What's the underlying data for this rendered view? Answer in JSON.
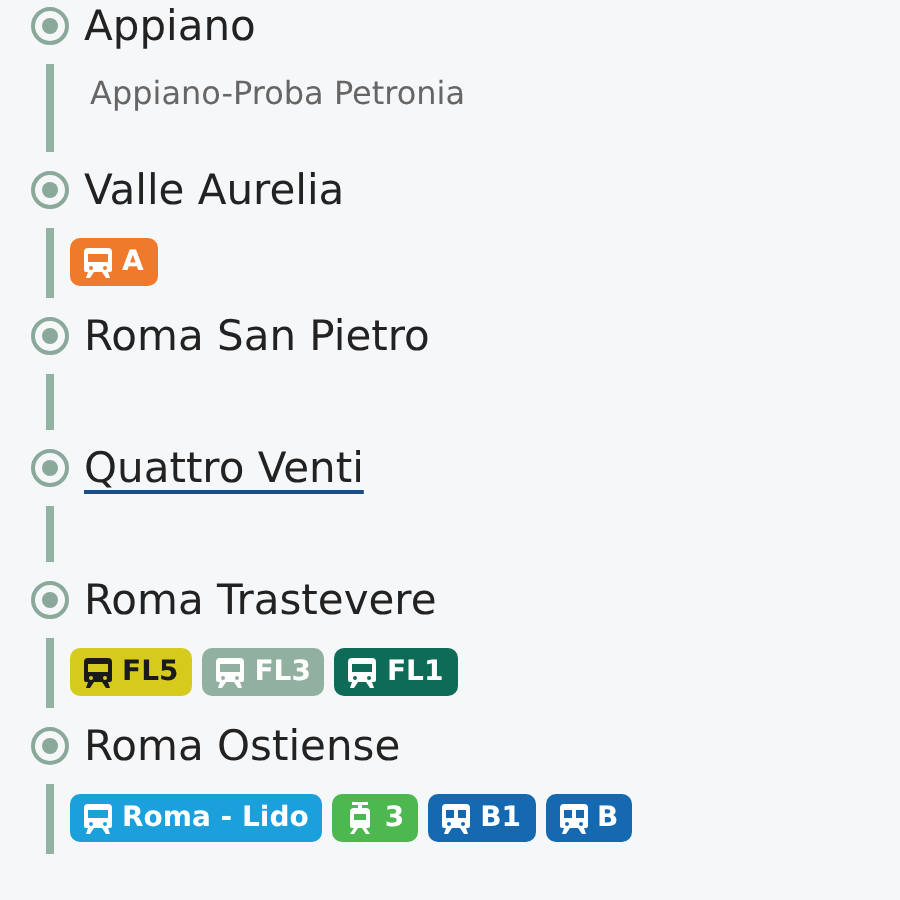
{
  "stops": [
    {
      "name": "Appiano",
      "link": false,
      "subtitle": "Appiano-Proba Petronia"
    },
    {
      "name": "Valle Aurelia",
      "link": false,
      "lines": [
        {
          "label": "A",
          "kind": "train",
          "color": "#ef7a2c",
          "dark_text": false
        }
      ]
    },
    {
      "name": "Roma San Pietro",
      "link": false
    },
    {
      "name": "Quattro Venti",
      "link": true
    },
    {
      "name": "Roma Trastevere",
      "link": false,
      "lines": [
        {
          "label": "FL5",
          "kind": "train",
          "color": "#d6cb1c",
          "dark_text": true
        },
        {
          "label": "FL3",
          "kind": "train",
          "color": "#92b09f",
          "dark_text": false
        },
        {
          "label": "FL1",
          "kind": "train",
          "color": "#0d6b58",
          "dark_text": false
        }
      ]
    },
    {
      "name": "Roma Ostiense",
      "link": false,
      "lines": [
        {
          "label": "Roma - Lido",
          "kind": "train",
          "color": "#1ca0dc",
          "dark_text": false
        },
        {
          "label": "3",
          "kind": "tram",
          "color": "#4db84f",
          "dark_text": false
        },
        {
          "label": "B1",
          "kind": "metro",
          "color": "#1469b1",
          "dark_text": false
        },
        {
          "label": "B",
          "kind": "metro",
          "color": "#1469b1",
          "dark_text": false
        }
      ]
    }
  ]
}
